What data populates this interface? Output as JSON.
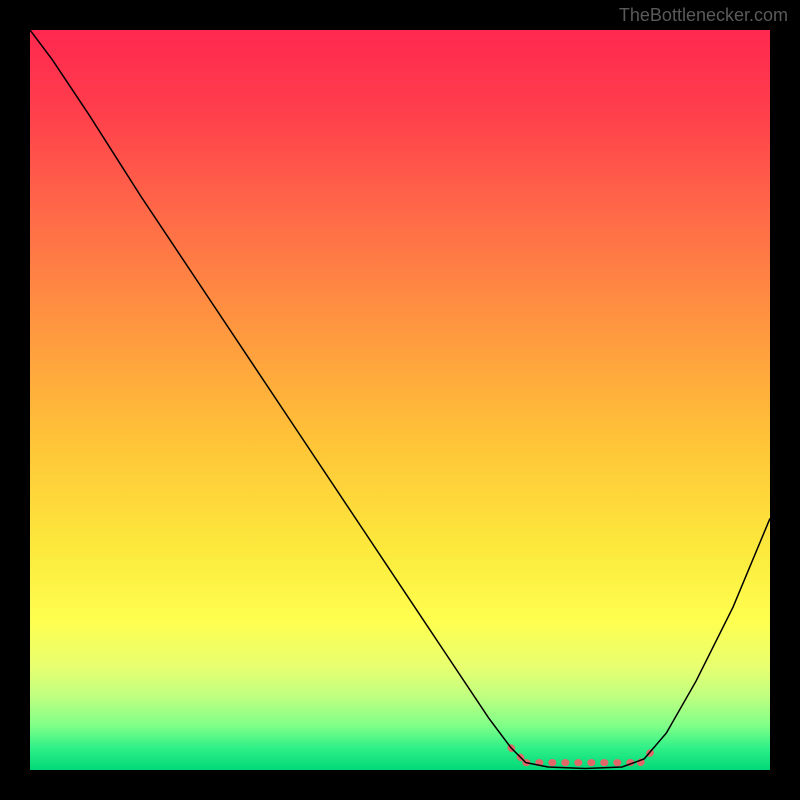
{
  "watermark": "TheBottlenecker.com",
  "chart_data": {
    "type": "line",
    "title": "",
    "xlabel": "",
    "ylabel": "",
    "xlim": [
      0,
      100
    ],
    "ylim": [
      0,
      100
    ],
    "background": {
      "type": "vertical-gradient",
      "stops": [
        {
          "offset": 0.0,
          "color": "#ff2850"
        },
        {
          "offset": 0.1,
          "color": "#ff3c4c"
        },
        {
          "offset": 0.25,
          "color": "#ff6a48"
        },
        {
          "offset": 0.4,
          "color": "#ff9640"
        },
        {
          "offset": 0.55,
          "color": "#ffc238"
        },
        {
          "offset": 0.7,
          "color": "#fce93c"
        },
        {
          "offset": 0.8,
          "color": "#feff50"
        },
        {
          "offset": 0.86,
          "color": "#e8ff70"
        },
        {
          "offset": 0.9,
          "color": "#c0ff80"
        },
        {
          "offset": 0.94,
          "color": "#80ff88"
        },
        {
          "offset": 0.97,
          "color": "#30f088"
        },
        {
          "offset": 1.0,
          "color": "#00d878"
        }
      ]
    },
    "series": [
      {
        "name": "bottleneck-curve",
        "color": "#000000",
        "width": 1.5,
        "points": [
          {
            "x": 0.0,
            "y": 100.0
          },
          {
            "x": 3.0,
            "y": 96.0
          },
          {
            "x": 8.0,
            "y": 88.5
          },
          {
            "x": 15.0,
            "y": 77.5
          },
          {
            "x": 25.0,
            "y": 62.5
          },
          {
            "x": 35.0,
            "y": 47.5
          },
          {
            "x": 45.0,
            "y": 32.5
          },
          {
            "x": 55.0,
            "y": 17.5
          },
          {
            "x": 62.0,
            "y": 7.0
          },
          {
            "x": 65.0,
            "y": 3.0
          },
          {
            "x": 67.0,
            "y": 1.0
          },
          {
            "x": 70.0,
            "y": 0.4
          },
          {
            "x": 75.0,
            "y": 0.2
          },
          {
            "x": 80.0,
            "y": 0.4
          },
          {
            "x": 83.0,
            "y": 1.5
          },
          {
            "x": 86.0,
            "y": 5.0
          },
          {
            "x": 90.0,
            "y": 12.0
          },
          {
            "x": 95.0,
            "y": 22.0
          },
          {
            "x": 100.0,
            "y": 34.0
          }
        ]
      },
      {
        "name": "optimal-zone-marker",
        "type": "marker-line",
        "color": "#e06868",
        "width": 7,
        "segments": [
          {
            "x1": 65.0,
            "y1": 3.0,
            "x2": 67.0,
            "y2": 1.0
          },
          {
            "x1": 67.0,
            "y1": 1.0,
            "x2": 82.5,
            "y2": 1.0
          },
          {
            "x1": 82.5,
            "y1": 1.0,
            "x2": 84.5,
            "y2": 3.0
          }
        ]
      }
    ]
  }
}
